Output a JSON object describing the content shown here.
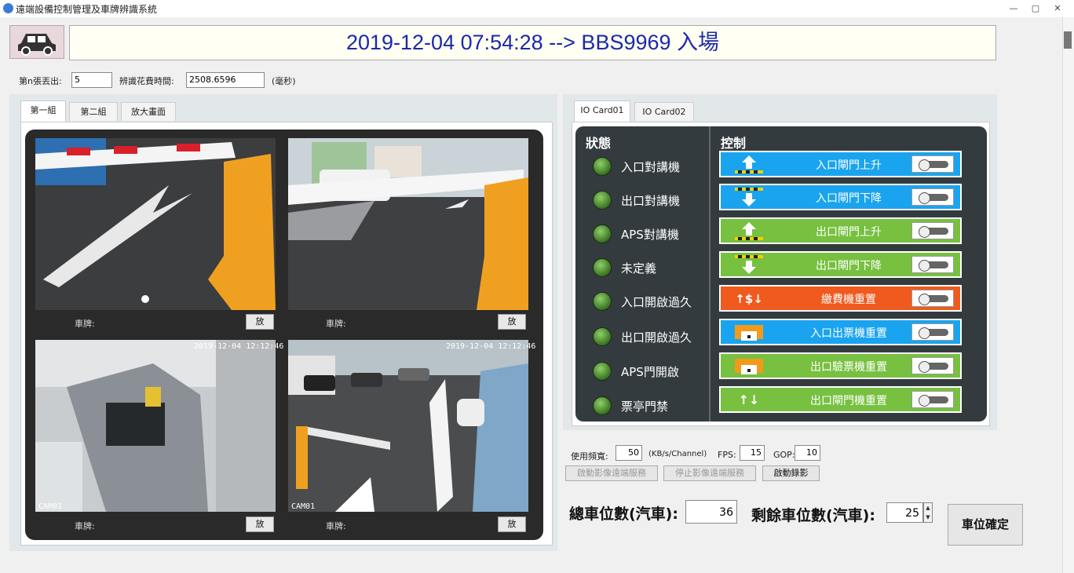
{
  "window": {
    "title": "遠端設備控制管理及車牌辨識系統",
    "controls": {
      "minimize": "—",
      "restore": "▢",
      "close": "✕"
    }
  },
  "header": {
    "banner_text": "2019-12-04 07:54:28 --> BBS9969 入場",
    "field1_label": "第n張丟出:",
    "field1_value": "5",
    "field2_label": "辨識花費時間:",
    "field2_value": "2508.6596",
    "field2_unit": "(毫秒)"
  },
  "camera_tabs": [
    "第一組",
    "第二組",
    "放大畫面"
  ],
  "cameras": [
    {
      "plate_label": "車牌:",
      "zoom_label": "放",
      "overlay_time": "",
      "overlay_cam": ""
    },
    {
      "plate_label": "車牌:",
      "zoom_label": "放",
      "overlay_time": "",
      "overlay_cam": ""
    },
    {
      "plate_label": "車牌:",
      "zoom_label": "放",
      "overlay_time": "2019-12-04 12:12:46",
      "overlay_cam": "CAM01"
    },
    {
      "plate_label": "車牌:",
      "zoom_label": "放",
      "overlay_time": "2019-12-04 12:12:46",
      "overlay_cam": "CAM01"
    }
  ],
  "io_tabs": [
    "IO Card01",
    "IO Card02"
  ],
  "io": {
    "status_header": "狀態",
    "control_header": "控制",
    "status_items": [
      "入口對講機",
      "出口對講機",
      "APS對講機",
      "未定義",
      "入口開啟過久",
      "出口開啟過久",
      "APS門開啟",
      "票亭門禁"
    ],
    "controls": [
      {
        "label": "入口閘門上升",
        "color": "#1aa4ef",
        "icon": "arrow-up-barrier-icon"
      },
      {
        "label": "入口閘門下降",
        "color": "#1aa4ef",
        "icon": "arrow-down-barrier-icon"
      },
      {
        "label": "出口閘門上升",
        "color": "#77c040",
        "icon": "arrow-up-barrier-icon"
      },
      {
        "label": "出口閘門下降",
        "color": "#77c040",
        "icon": "arrow-down-barrier-icon"
      },
      {
        "label": "繳費機重置",
        "color": "#f05a1e",
        "icon": "payment-reset-icon"
      },
      {
        "label": "入口出票機重置",
        "color": "#1aa4ef",
        "icon": "ticket-machine-icon"
      },
      {
        "label": "出口驗票機重置",
        "color": "#77c040",
        "icon": "ticket-machine-icon"
      },
      {
        "label": "出口閘門機重置",
        "color": "#77c040",
        "icon": "up-down-arrows-icon"
      }
    ],
    "payment_icon_text": "↑$↓",
    "updown_icon_text": "↑↓"
  },
  "stream": {
    "bandwidth_label": "使用頻寬:",
    "bandwidth_value": "50",
    "bandwidth_unit": "(KB/s/Channel)",
    "fps_label": "FPS:",
    "fps_value": "15",
    "gop_label": "GOP:",
    "gop_value": "10",
    "start_service_label": "啟動影像遠端服務",
    "stop_service_label": "停止影像遠端服務",
    "record_label": "啟動錄影"
  },
  "parking": {
    "total_label": "總車位數(汽車):",
    "total_value": "36",
    "remain_label": "剩餘車位數(汽車):",
    "remain_value": "25",
    "confirm_label": "車位確定"
  }
}
